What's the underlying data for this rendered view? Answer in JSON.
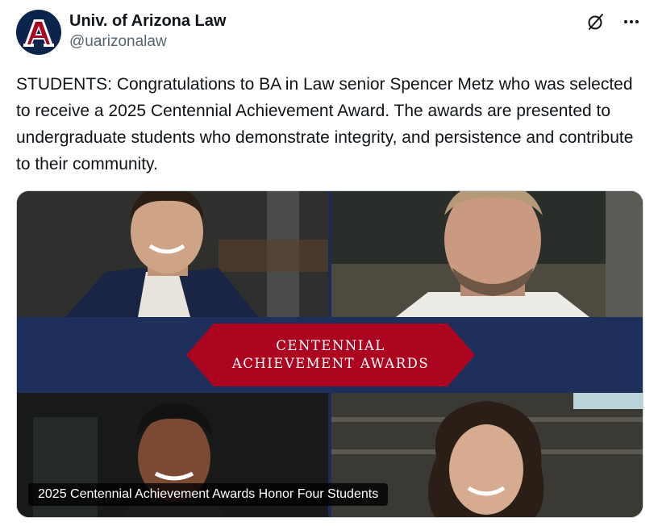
{
  "author": {
    "name": "Univ. of Arizona Law",
    "handle": "@uarizonalaw"
  },
  "header": {
    "grok_icon": "grok-icon",
    "more_icon": "more-icon"
  },
  "tweet": {
    "text": "STUDENTS: Congratulations to BA in Law senior Spencer Metz who was selected to receive a 2025 Centennial Achievement Award. The awards are presented to undergraduate students who demonstrate integrity, and persistence and contribute to their community."
  },
  "media": {
    "banner_line1": "CENTENNIAL",
    "banner_line2": "ACHIEVEMENT AWARDS",
    "caption": "2025 Centennial Achievement Awards Honor Four Students"
  },
  "colors": {
    "brand_navy": "#0c234b",
    "brand_red": "#ab0520",
    "band_navy": "#1e2f5c"
  }
}
